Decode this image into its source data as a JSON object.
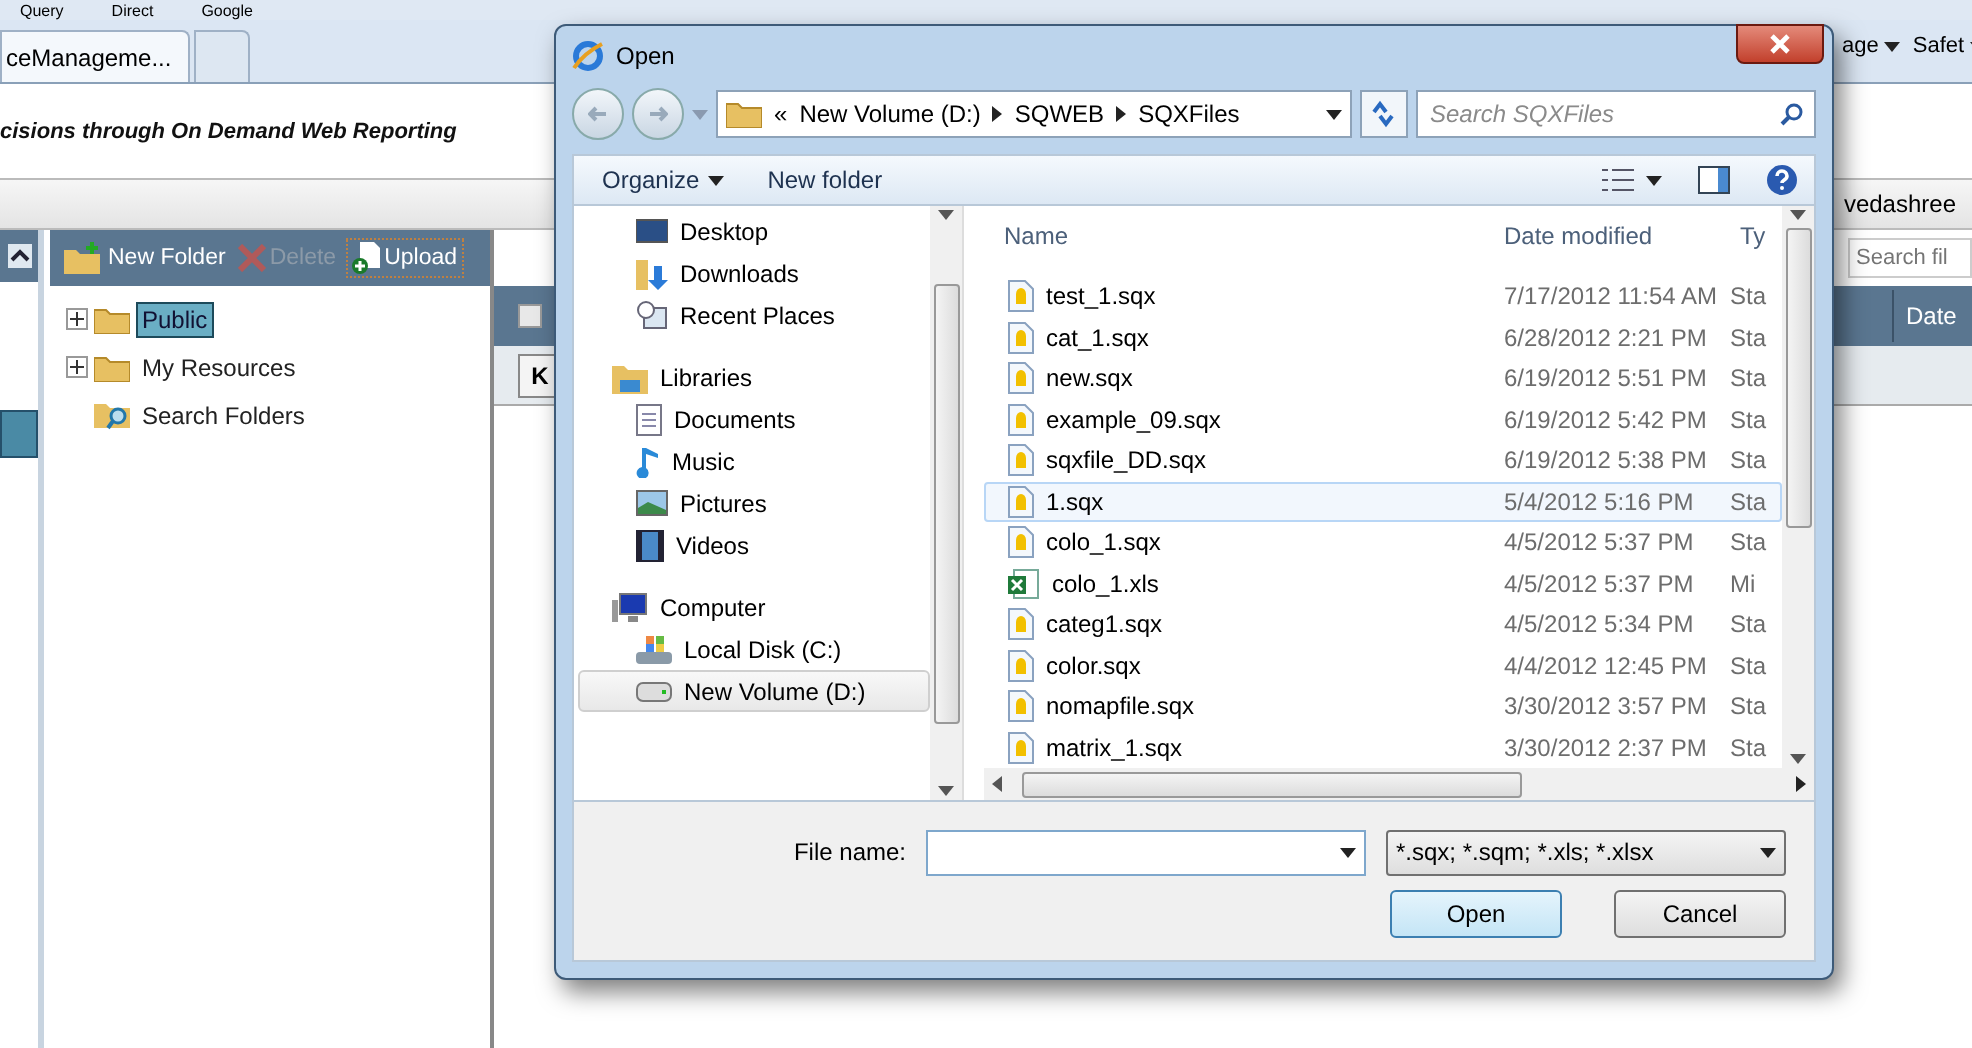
{
  "browser": {
    "favorites": [
      {
        "label": "Query"
      },
      {
        "label": "Direct"
      },
      {
        "label": "Google"
      }
    ],
    "tabs": [
      {
        "label": "ceManageme...",
        "selected": true
      },
      {
        "selected": false
      }
    ],
    "menus": [
      {
        "label": "age"
      },
      {
        "label": "Safet"
      }
    ],
    "user": "vedashree"
  },
  "app": {
    "tagline": "cisions through On Demand Web Reporting",
    "toolbar": [
      {
        "kind": "new-folder",
        "label": "New Folder",
        "disabled": false
      },
      {
        "kind": "delete",
        "label": "Delete",
        "disabled": true
      },
      {
        "kind": "upload",
        "label": "Upload",
        "disabled": false
      }
    ],
    "tree": [
      {
        "label": "Public",
        "kind": "folder",
        "expandable": true,
        "selected": true
      },
      {
        "label": "My Resources",
        "kind": "folder",
        "expandable": true,
        "selected": false
      },
      {
        "label": "Search Folders",
        "kind": "search",
        "expandable": false,
        "selected": false
      }
    ],
    "search": {
      "placeholder": "Search fil"
    },
    "header_checked": false,
    "columns": [
      "Date"
    ],
    "pager_button": "K"
  },
  "dialog": {
    "title": "Open",
    "breadcrumb": [
      "«",
      "New Volume (D:)",
      "SQWEB",
      "SQXFiles"
    ],
    "search": {
      "placeholder": "Search SQXFiles"
    },
    "toolbar": [
      {
        "label": "Organize",
        "menu": true
      },
      {
        "label": "New folder",
        "menu": false
      }
    ],
    "nav": [
      {
        "label": "Desktop",
        "kind": "desktop",
        "group": false,
        "selected": false
      },
      {
        "label": "Downloads",
        "kind": "downloads",
        "group": false,
        "selected": false
      },
      {
        "label": "Recent Places",
        "kind": "recent",
        "group": false,
        "selected": false
      },
      {
        "label": "Libraries",
        "kind": "libraries",
        "group": true,
        "selected": false
      },
      {
        "label": "Documents",
        "kind": "documents",
        "group": false,
        "selected": false
      },
      {
        "label": "Music",
        "kind": "music",
        "group": false,
        "selected": false
      },
      {
        "label": "Pictures",
        "kind": "pictures",
        "group": false,
        "selected": false
      },
      {
        "label": "Videos",
        "kind": "videos",
        "group": false,
        "selected": false
      },
      {
        "label": "Computer",
        "kind": "computer",
        "group": true,
        "selected": false
      },
      {
        "label": "Local Disk (C:)",
        "kind": "disk",
        "group": false,
        "selected": false
      },
      {
        "label": "New Volume (D:)",
        "kind": "drive",
        "group": false,
        "selected": true
      }
    ],
    "columns": [
      "Name",
      "Date modified",
      "Ty"
    ],
    "files": [
      {
        "name": "test_1.sqx",
        "date": "7/17/2012 11:54 AM",
        "type": "Sta",
        "kind": "sqx",
        "selected": false
      },
      {
        "name": "cat_1.sqx",
        "date": "6/28/2012 2:21 PM",
        "type": "Sta",
        "kind": "sqx",
        "selected": false
      },
      {
        "name": "new.sqx",
        "date": "6/19/2012 5:51 PM",
        "type": "Sta",
        "kind": "sqx",
        "selected": false
      },
      {
        "name": "example_09.sqx",
        "date": "6/19/2012 5:42 PM",
        "type": "Sta",
        "kind": "sqx",
        "selected": false
      },
      {
        "name": "sqxfile_DD.sqx",
        "date": "6/19/2012 5:38 PM",
        "type": "Sta",
        "kind": "sqx",
        "selected": false
      },
      {
        "name": "1.sqx",
        "date": "5/4/2012 5:16 PM",
        "type": "Sta",
        "kind": "sqx",
        "selected": true
      },
      {
        "name": "colo_1.sqx",
        "date": "4/5/2012 5:37 PM",
        "type": "Sta",
        "kind": "sqx",
        "selected": false
      },
      {
        "name": "colo_1.xls",
        "date": "4/5/2012 5:37 PM",
        "type": "Mi",
        "kind": "xls",
        "selected": false
      },
      {
        "name": "categ1.sqx",
        "date": "4/5/2012 5:34 PM",
        "type": "Sta",
        "kind": "sqx",
        "selected": false
      },
      {
        "name": "color.sqx",
        "date": "4/4/2012 12:45 PM",
        "type": "Sta",
        "kind": "sqx",
        "selected": false
      },
      {
        "name": "nomapfile.sqx",
        "date": "3/30/2012 3:57 PM",
        "type": "Sta",
        "kind": "sqx",
        "selected": false
      },
      {
        "name": "matrix_1.sqx",
        "date": "3/30/2012 2:37 PM",
        "type": "Sta",
        "kind": "sqx",
        "selected": false
      }
    ],
    "file_name_label": "File name:",
    "file_type": "*.sqx; *.sqm; *.xls; *.xlsx",
    "buttons": [
      {
        "label": "Open",
        "default": true
      },
      {
        "label": "Cancel",
        "default": false
      }
    ]
  }
}
